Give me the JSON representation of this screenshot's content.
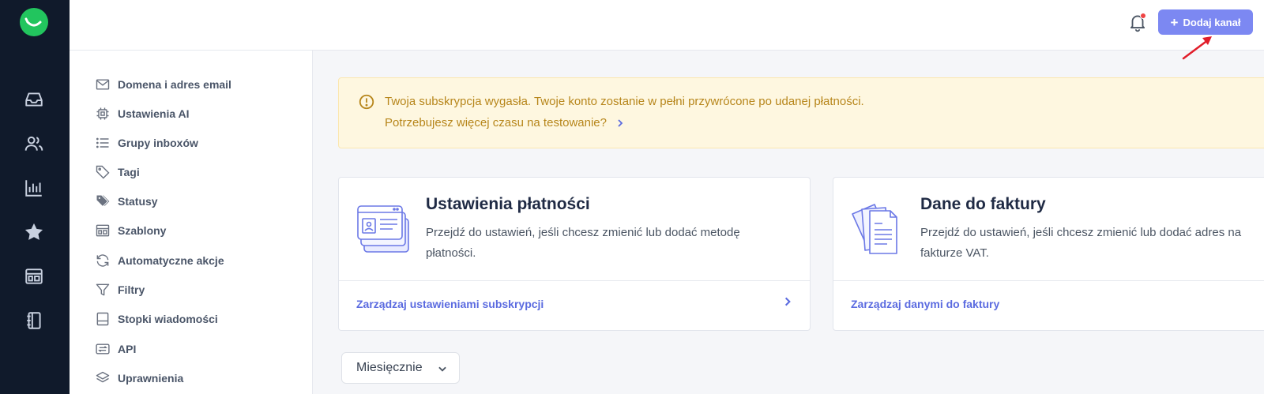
{
  "header": {
    "add_channel_label": "Dodaj kanał"
  },
  "rail": {
    "icons": [
      "inbox-icon",
      "users-icon",
      "reports-icon",
      "star-icon",
      "dashboard-icon",
      "contacts-book-icon"
    ]
  },
  "sidebar": {
    "items": [
      {
        "label": "Domena i adres email",
        "icon": "envelope-icon"
      },
      {
        "label": "Ustawienia AI",
        "icon": "chip-icon"
      },
      {
        "label": "Grupy inboxów",
        "icon": "list-icon"
      },
      {
        "label": "Tagi",
        "icon": "tag-icon"
      },
      {
        "label": "Statusy",
        "icon": "tags-icon"
      },
      {
        "label": "Szablony",
        "icon": "template-icon"
      },
      {
        "label": "Automatyczne akcje",
        "icon": "refresh-icon"
      },
      {
        "label": "Filtry",
        "icon": "filter-icon"
      },
      {
        "label": "Stopki wiadomości",
        "icon": "footer-icon"
      },
      {
        "label": "API",
        "icon": "api-icon"
      },
      {
        "label": "Uprawnienia",
        "icon": "layers-icon"
      }
    ]
  },
  "alert": {
    "line1": "Twoja subskrypcja wygasła. Twoje konto zostanie w pełni przywrócone po udanej płatności.",
    "line2": "Potrzebujesz więcej czasu na testowanie?"
  },
  "cards": {
    "payment": {
      "title": "Ustawienia płatności",
      "description": "Przejdź do ustawień, jeśli chcesz zmienić lub dodać metodę płatności.",
      "link": "Zarządzaj ustawieniami subskrypcji"
    },
    "invoice": {
      "title": "Dane do faktury",
      "description": "Przejdź do ustawień, jeśli chcesz zmienić lub dodać adres na fakturze VAT.",
      "link": "Zarządzaj danymi do faktury"
    }
  },
  "billing_period": {
    "selected": "Miesięcznie"
  },
  "colors": {
    "accent": "#7c88f2",
    "link": "#5b6be0",
    "rail": "#101a2b",
    "alert_text": "#b7861b",
    "alert_bg": "#fef7e0"
  }
}
